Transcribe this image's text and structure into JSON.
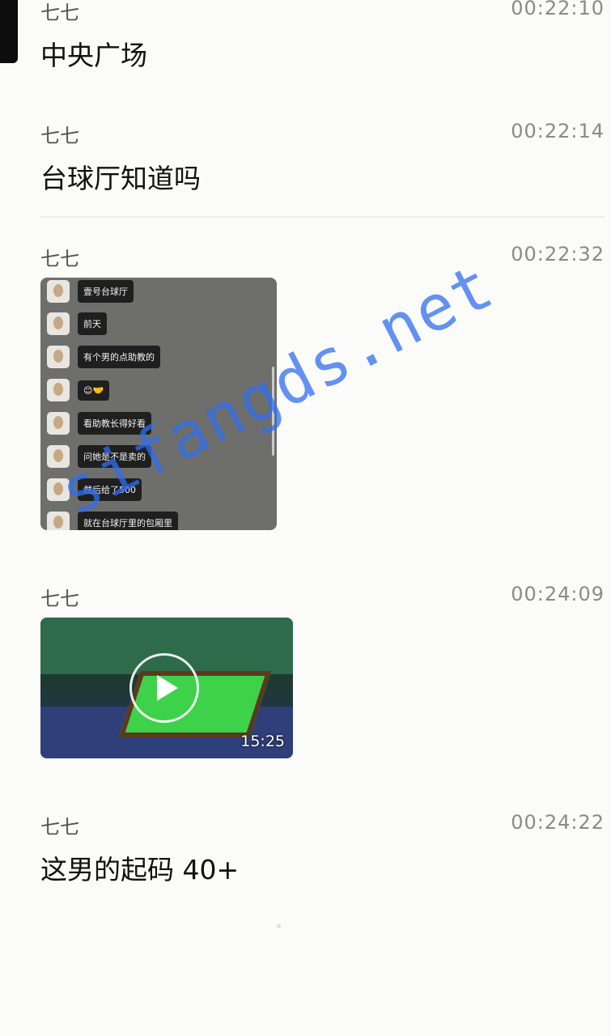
{
  "messages": [
    {
      "sender": "七七",
      "time": "00:22:10",
      "text": "中央广场"
    },
    {
      "sender": "七七",
      "time": "00:22:14",
      "text": "台球厅知道吗"
    },
    {
      "sender": "七七",
      "time": "00:22:32"
    },
    {
      "sender": "七七",
      "time": "00:24:09"
    },
    {
      "sender": "七七",
      "time": "00:24:22",
      "text": "这男的起码 40+"
    }
  ],
  "image_chat": [
    "壹号台球厅",
    "前天",
    "有个男的点助教的",
    "😊🤝",
    "看助教长得好看",
    "问她是不是卖的",
    "然后给了500",
    "就在台球厅里的包厢里"
  ],
  "video": {
    "duration": "15:25"
  },
  "watermark": "sifangds.net"
}
